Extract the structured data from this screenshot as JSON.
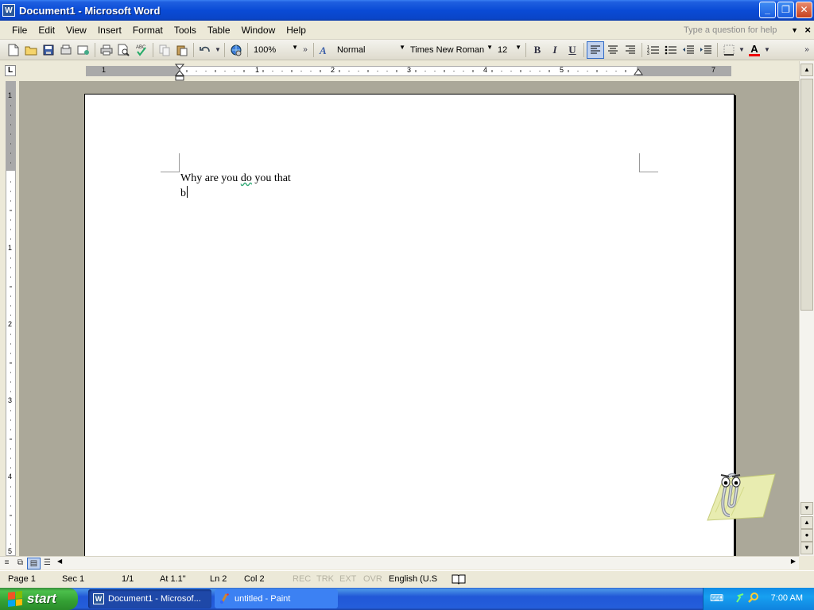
{
  "window": {
    "title": "Document1 - Microsoft Word",
    "app_icon": "W"
  },
  "menu": [
    "File",
    "Edit",
    "View",
    "Insert",
    "Format",
    "Tools",
    "Table",
    "Window",
    "Help"
  ],
  "help_box": {
    "placeholder": "Type a question for help"
  },
  "toolbar": {
    "zoom": "100%",
    "style": "Normal",
    "font": "Times New Roman",
    "size": "12",
    "bold": "B",
    "italic": "I",
    "underline": "U",
    "font_color_letter": "A",
    "font_color": "#e00000"
  },
  "ruler": {
    "h_numbers": [
      "1",
      "1",
      "2",
      "3",
      "4",
      "5",
      "7"
    ],
    "v_numbers": [
      "1",
      "1",
      "2",
      "3",
      "4",
      "5"
    ]
  },
  "document": {
    "line1_a": "Why are you ",
    "line1_squiggle": "do",
    "line1_b": " you that",
    "line2": "b"
  },
  "statusbar": {
    "page": "Page  1",
    "sec": "Sec  1",
    "pages": "1/1",
    "at": "At  1.1\"",
    "ln": "Ln  2",
    "col": "Col  2",
    "rec": "REC",
    "trk": "TRK",
    "ext": "EXT",
    "ovr": "OVR",
    "language": "English (U.S"
  },
  "taskbar": {
    "start": "start",
    "tasks": [
      {
        "label": "Document1 - Microsof...",
        "icon": "W"
      },
      {
        "label": "untitled - Paint"
      }
    ],
    "clock": "7:00 AM"
  }
}
